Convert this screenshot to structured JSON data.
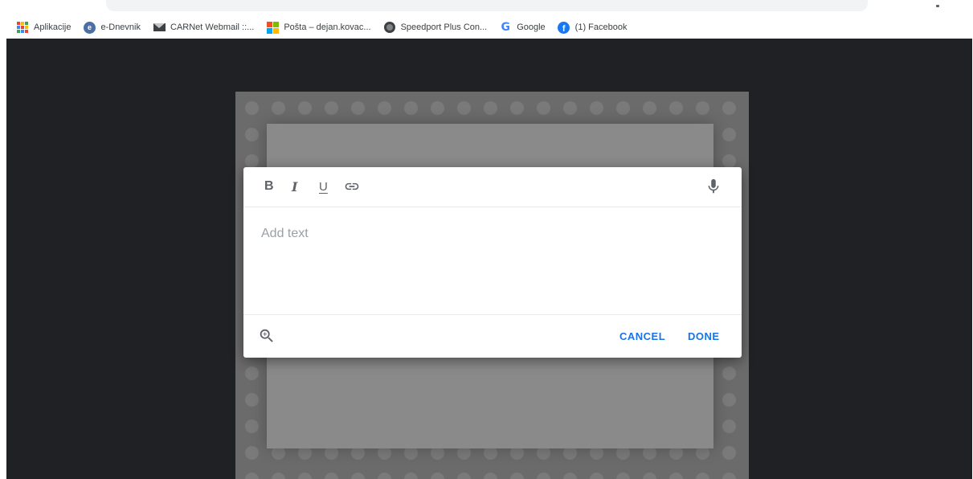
{
  "bookmarks": [
    {
      "label": "Aplikacije",
      "icon": "apps-grid-icon"
    },
    {
      "label": "e-Dnevnik",
      "icon": "e-dnevnik-icon"
    },
    {
      "label": "CARNet Webmail ::...",
      "icon": "mail-icon"
    },
    {
      "label": "Pošta – dejan.kovac...",
      "icon": "microsoft-icon"
    },
    {
      "label": "Speedport Plus Con...",
      "icon": "globe-icon"
    },
    {
      "label": "Google",
      "icon": "google-icon"
    },
    {
      "label": "(1) Facebook",
      "icon": "facebook-icon"
    }
  ],
  "editor": {
    "toolbar": {
      "bold": "B",
      "italic": "I",
      "underline": "U"
    },
    "placeholder": "Add text",
    "cancel_label": "CANCEL",
    "done_label": "DONE"
  },
  "colors": {
    "page_background": "#202124",
    "dialog_background": "#ffffff",
    "accent": "#1a73e8",
    "icon_gray": "#5f6368",
    "placeholder_gray": "#9aa0a6"
  }
}
